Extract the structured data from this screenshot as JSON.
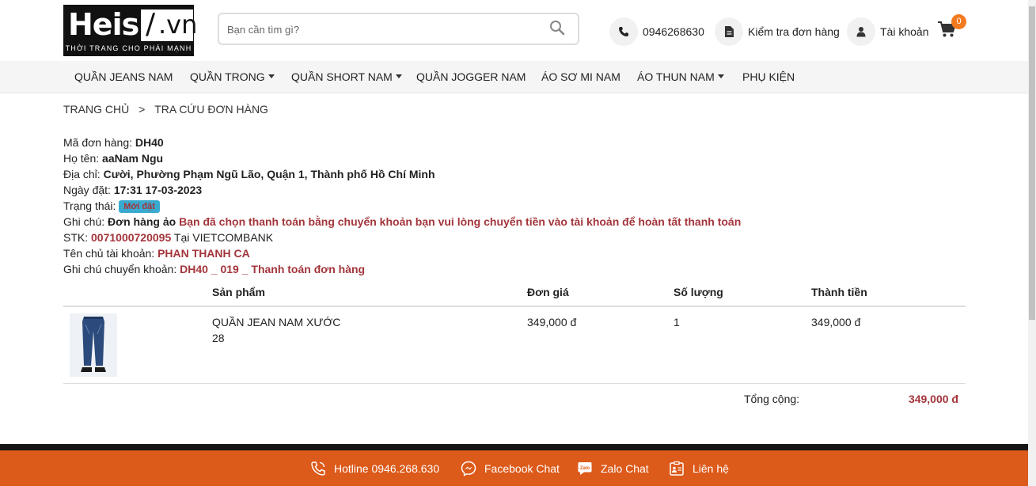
{
  "brand": {
    "logo_text": "Heis",
    "logo_slash": "/",
    "logo_domain": ".vn",
    "tagline": "THỜI TRANG CHO PHÁI MẠNH"
  },
  "search": {
    "placeholder": "Bạn cần tìm gì?"
  },
  "header": {
    "phone": "0946268630",
    "order_check": "Kiểm tra đơn hàng",
    "account": "Tài khoản",
    "cart_count": "0"
  },
  "nav": {
    "items": [
      {
        "label": "QUẦN JEANS NAM",
        "dropdown": false
      },
      {
        "label": "QUẦN TRONG",
        "dropdown": true
      },
      {
        "label": "QUẦN SHORT NAM",
        "dropdown": true
      },
      {
        "label": "QUẦN JOGGER NAM",
        "dropdown": false
      },
      {
        "label": "ÁO SƠ MI NAM",
        "dropdown": false
      },
      {
        "label": "ÁO THUN NAM",
        "dropdown": true
      },
      {
        "label": "PHỤ KIỆN",
        "dropdown": false
      }
    ]
  },
  "breadcrumb": {
    "home": "TRANG CHỦ",
    "separator": ">",
    "current": "TRA CỨU ĐƠN HÀNG"
  },
  "order": {
    "id_label": "Mã đơn hàng: ",
    "id": "DH40",
    "name_label": "Họ tên: ",
    "name": "aaNam Ngu",
    "address_label": "Địa chỉ: ",
    "address": "Cười, Phường Phạm Ngũ Lão, Quận 1, Thành phố Hồ Chí Minh",
    "date_label": "Ngày đặt: ",
    "date": "17:31 17-03-2023",
    "status_label": "Trạng thái: ",
    "status": "Mới đặt",
    "note_label": "Ghi chú: ",
    "note": "Đơn hàng ảo",
    "note_payment": "Bạn đã chọn thanh toán bằng chuyển khoản bạn vui lòng chuyển tiền vào tài khoản để hoàn tất thanh toán",
    "account_number_label": "STK: ",
    "account_number": "0071000720095",
    "bank_text": " Tại VIETCOMBANK",
    "account_owner_label": "Tên chủ tài khoản: ",
    "account_owner": "PHAN THANH CA",
    "transfer_note_label": "Ghi chú chuyển khoản: ",
    "transfer_note": "DH40 _ 019 _ Thanh toán đơn hàng"
  },
  "table": {
    "headers": [
      "Sản phẩm",
      "Đơn giá",
      "Số lượng",
      "Thành tiền"
    ],
    "rows": [
      {
        "product": "QUẦN JEAN NAM XƯỚC",
        "size": "28",
        "price": "349,000 đ",
        "qty": "1",
        "subtotal": "349,000 đ",
        "image": "jeans-product-thumbnail"
      }
    ],
    "total_label": "Tổng cộng:",
    "total_value": "349,000 đ"
  },
  "footer": {
    "hotline": "Hotline 0946.268.630",
    "facebook": "Facebook Chat",
    "zalo": "Zalo Chat",
    "contact": "Liên hệ"
  },
  "colors": {
    "accent_red": "#a3353b",
    "footer_orange": "#dc5a1a",
    "badge_orange": "#f47a20",
    "status_blue": "#3aa9cf"
  }
}
